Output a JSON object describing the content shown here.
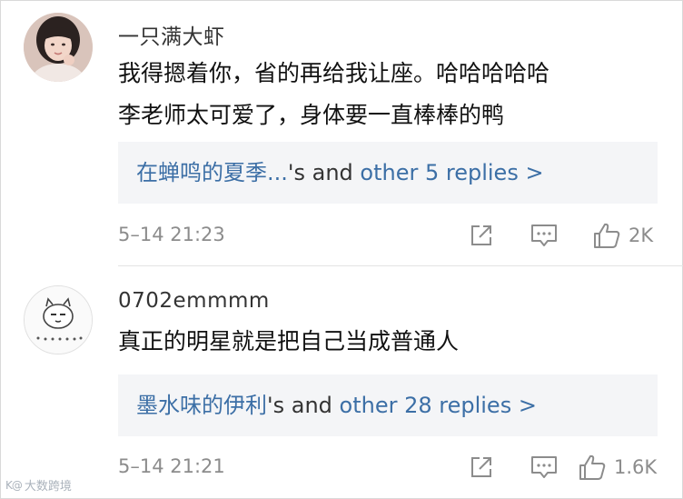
{
  "comments": [
    {
      "username": "一只满大虾",
      "text_lines": [
        "我得摁着你，省的再给我让座。哈哈哈哈哈",
        "李老师太可爱了，身体要一直棒棒的鸭"
      ],
      "reply_preview": {
        "name": "在蝉鸣的夏季...",
        "middle": "'s and ",
        "other": "other 5 replies >"
      },
      "timestamp": "5–14 21:23",
      "likes": "2K",
      "avatar_icon": "avatar-photo"
    },
    {
      "username": "0702emmmm",
      "text_lines": [
        "真正的明星就是把自己当成普通人"
      ],
      "reply_preview": {
        "name": "墨水味的伊利",
        "middle": "'s and ",
        "other": "other 28 replies >"
      },
      "timestamp": "5–14 21:21",
      "likes": "1.6K",
      "avatar_icon": "cartoon-face-avatar"
    }
  ],
  "icons": {
    "share": "share-icon",
    "reply": "comment-icon",
    "like": "thumbs-up-icon"
  },
  "colors": {
    "link": "#3c6fa6",
    "meta": "#8c8c8c",
    "reply_bg": "#f4f5f7"
  },
  "watermark": {
    "logo": "K@",
    "text": "大数跨境"
  }
}
